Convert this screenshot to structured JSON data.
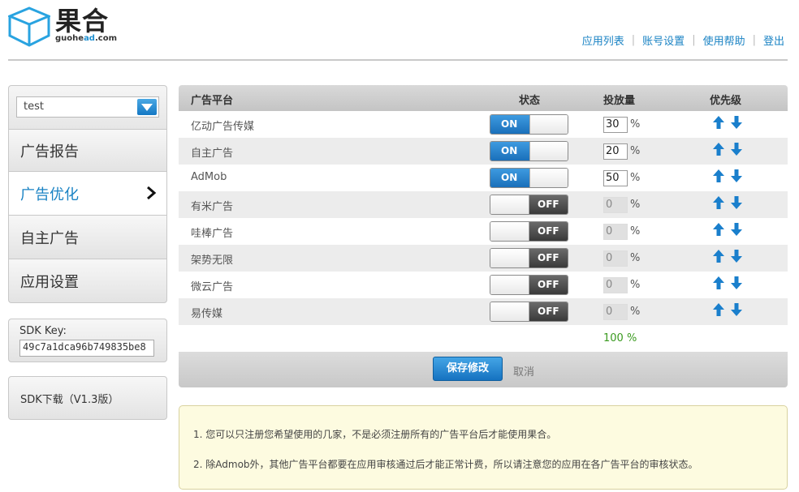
{
  "logo": {
    "name_cn": "果合",
    "domain_main": "guohe",
    "domain_ad": "ad",
    "domain_tld": ".com"
  },
  "topnav": [
    "应用列表",
    "账号设置",
    "使用帮助",
    "登出"
  ],
  "sidebar": {
    "app_select": {
      "value": "test"
    },
    "items": [
      {
        "label": "广告报告",
        "active": false
      },
      {
        "label": "广告优化",
        "active": true
      },
      {
        "label": "自主广告",
        "active": false
      },
      {
        "label": "应用设置",
        "active": false
      }
    ],
    "sdk_key": {
      "label": "SDK Key:",
      "value": "49c7a1dca96b749835be8"
    },
    "sdk_download": {
      "label": "SDK下载（V1.3版）"
    }
  },
  "table": {
    "headers": {
      "platform": "广告平台",
      "status": "状态",
      "quantity": "投放量",
      "priority": "优先级"
    },
    "on_label": "ON",
    "off_label": "OFF",
    "pct_symbol": "%",
    "rows": [
      {
        "name": "亿动广告传媒",
        "on": true,
        "qty": "30"
      },
      {
        "name": "自主广告",
        "on": true,
        "qty": "20"
      },
      {
        "name": "AdMob",
        "on": true,
        "qty": "50"
      },
      {
        "name": "有米广告",
        "on": false,
        "qty": "0"
      },
      {
        "name": "哇棒广告",
        "on": false,
        "qty": "0"
      },
      {
        "name": "架势无限",
        "on": false,
        "qty": "0"
      },
      {
        "name": "微云广告",
        "on": false,
        "qty": "0"
      },
      {
        "name": "易传媒",
        "on": false,
        "qty": "0"
      }
    ],
    "total": "100 %",
    "save_label": "保存修改",
    "cancel_label": "取消"
  },
  "notes": [
    "1.  您可以只注册您希望使用的几家，不是必须注册所有的广告平台后才能使用果合。",
    "2.  除Admob外，其他广告平台都要在应用审核通过后才能正常计费，所以请注意您的应用在各广告平台的审核状态。"
  ],
  "colors": {
    "accent": "#1a83c4",
    "total_green": "#3a9a1f"
  }
}
